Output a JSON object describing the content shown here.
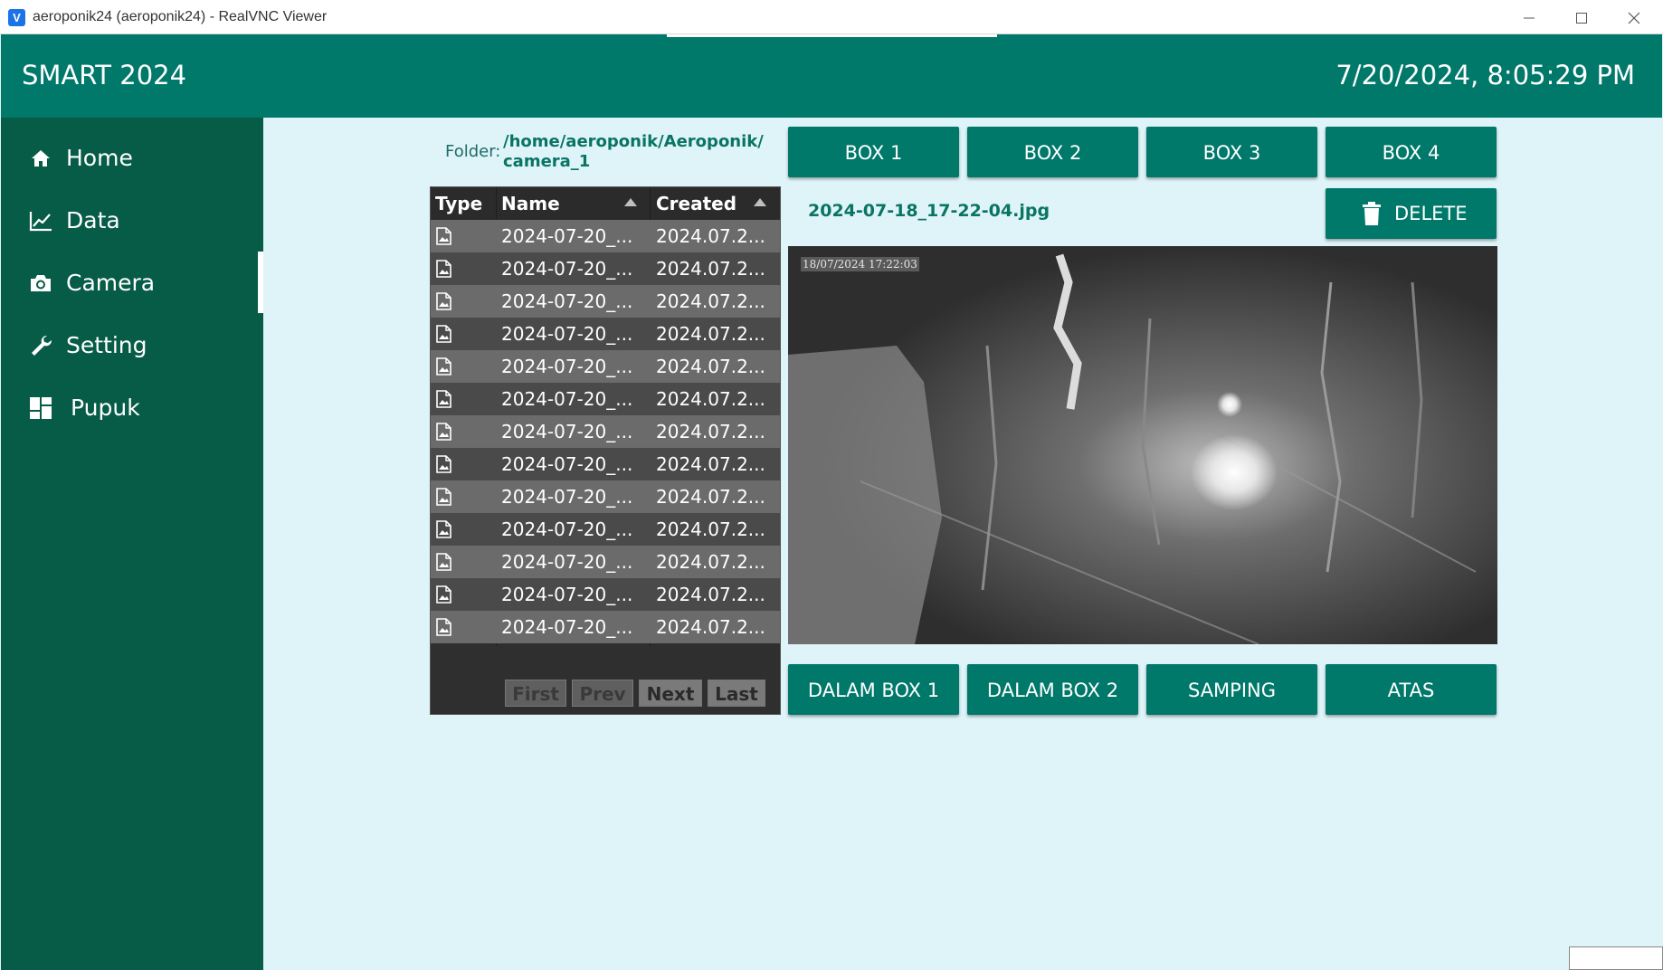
{
  "window": {
    "title": "aeroponik24 (aeroponik24) - RealVNC Viewer",
    "app_icon": "V"
  },
  "header": {
    "title": "SMART 2024",
    "datetime": "7/20/2024, 8:05:29 PM"
  },
  "sidebar": {
    "items": [
      {
        "label": "Home",
        "icon": "home-icon"
      },
      {
        "label": "Data",
        "icon": "chart-line-icon"
      },
      {
        "label": "Camera",
        "icon": "camera-icon"
      },
      {
        "label": "Setting",
        "icon": "wrench-icon"
      },
      {
        "label": "Pupuk",
        "icon": "dashboard-grid-icon"
      }
    ],
    "active": "Camera"
  },
  "folder": {
    "label": "Folder:",
    "path_line1": "/home/aeroponik/Aeroponik/",
    "path_line2": "camera_1"
  },
  "box_buttons": [
    "BOX 1",
    "BOX 2",
    "BOX 3",
    "BOX 4"
  ],
  "delete_button": "DELETE",
  "selected_file": "2024-07-18_17-22-04.jpg",
  "camera": {
    "timestamp": "18/07/2024 17:22:03"
  },
  "view_buttons": [
    "DALAM BOX 1",
    "DALAM BOX 2",
    "SAMPING",
    "ATAS"
  ],
  "file_table": {
    "columns": [
      "Type",
      "Name",
      "Created"
    ],
    "rows": [
      {
        "name": "2024-07-20_...",
        "created": "2024.07.2..."
      },
      {
        "name": "2024-07-20_...",
        "created": "2024.07.2..."
      },
      {
        "name": "2024-07-20_...",
        "created": "2024.07.2..."
      },
      {
        "name": "2024-07-20_...",
        "created": "2024.07.2..."
      },
      {
        "name": "2024-07-20_...",
        "created": "2024.07.2..."
      },
      {
        "name": "2024-07-20_...",
        "created": "2024.07.2..."
      },
      {
        "name": "2024-07-20_...",
        "created": "2024.07.2..."
      },
      {
        "name": "2024-07-20_...",
        "created": "2024.07.2..."
      },
      {
        "name": "2024-07-20_...",
        "created": "2024.07.2..."
      },
      {
        "name": "2024-07-20_...",
        "created": "2024.07.2..."
      },
      {
        "name": "2024-07-20_...",
        "created": "2024.07.2..."
      },
      {
        "name": "2024-07-20_...",
        "created": "2024.07.2..."
      },
      {
        "name": "2024-07-20_...",
        "created": "2024.07.2..."
      }
    ],
    "pager": [
      "First",
      "Prev",
      "Next",
      "Last"
    ]
  },
  "colors": {
    "header": "#00786a",
    "sidebar": "#075c47",
    "content_bg": "#dff4f9",
    "accent_text": "#0a7464"
  }
}
